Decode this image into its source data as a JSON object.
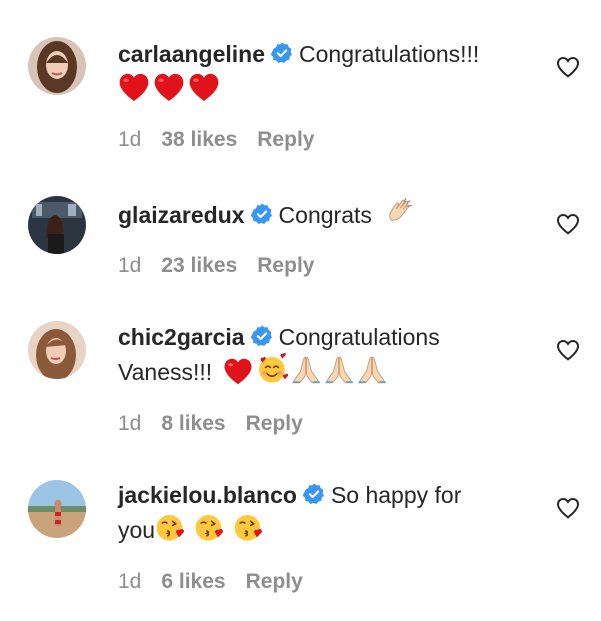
{
  "comments": [
    {
      "username": "carlaangeline",
      "text": "Congratulations!!!",
      "emojis": [
        "red-heart",
        "red-heart",
        "red-heart"
      ],
      "time": "1d",
      "likes": "38 likes",
      "reply": "Reply"
    },
    {
      "username": "glaizaredux",
      "text": "Congrats",
      "emojis": [
        "clapping-hands"
      ],
      "time": "1d",
      "likes": "23 likes",
      "reply": "Reply"
    },
    {
      "username": "chic2garcia",
      "text": "Congratulations",
      "text_line2": "Vaness!!!",
      "emojis": [
        "red-heart",
        "smiling-face-with-hearts",
        "folded-hands",
        "folded-hands",
        "folded-hands"
      ],
      "time": "1d",
      "likes": "8 likes",
      "reply": "Reply"
    },
    {
      "username": "jackielou.blanco",
      "text": "So happy for",
      "text_line2": "you",
      "emojis": [
        "face-blowing-kiss",
        "face-blowing-kiss",
        "face-blowing-kiss"
      ],
      "time": "1d",
      "likes": "6 likes",
      "reply": "Reply"
    }
  ],
  "colors": {
    "text": "#262626",
    "meta": "#8e8e8e",
    "verified_blue": "#3897f0",
    "heart_red": "#ed4956"
  }
}
